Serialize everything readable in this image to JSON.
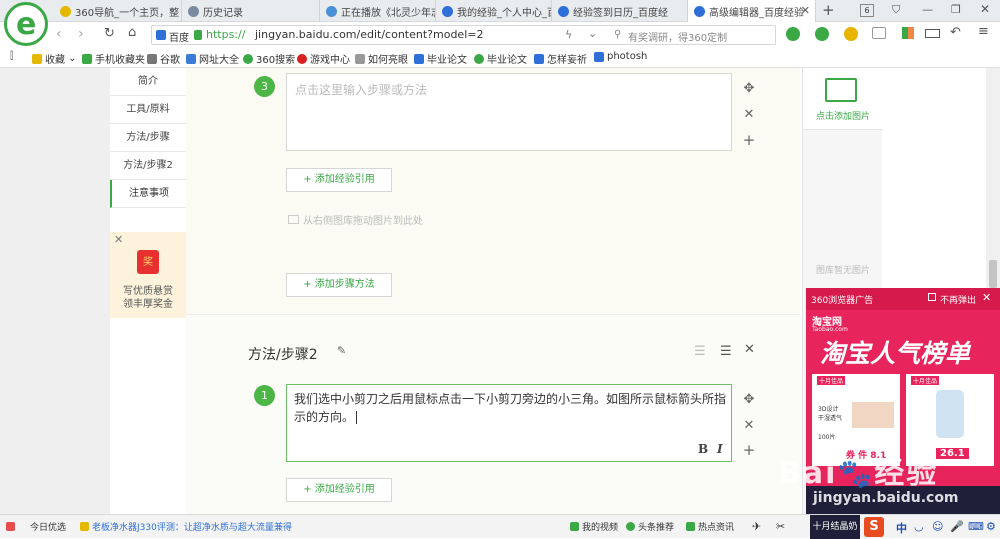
{
  "tabs": [
    {
      "label": "360导航_一个主页，整",
      "color": "#e5b800"
    },
    {
      "label": "历史记录",
      "color": "#7a8aa0"
    },
    {
      "label": "正在播放《北灵少年志",
      "color": "#4a8fd8"
    },
    {
      "label": "我的经验_个人中心_百",
      "color": "#2e6fd8"
    },
    {
      "label": "经验签到日历_百度经",
      "color": "#2e6fd8"
    },
    {
      "label": "高级编辑器_百度经验",
      "color": "#2e6fd8"
    }
  ],
  "tab_count": "6",
  "address": {
    "site_label": "百度",
    "protocol": "https://",
    "url": "jingyan.baidu.com/edit/content?model=2",
    "search_hint": "有奖调研，得360定制"
  },
  "bookmarks": [
    "收藏",
    "手机收藏夹",
    "谷歌",
    "网址大全",
    "360搜索",
    "游戏中心",
    "如何亮眼",
    "毕业论文",
    "毕业论文",
    "怎样妄祈",
    "photosh"
  ],
  "sidenav": [
    "简介",
    "工具/原料",
    "方法/步骤",
    "方法/步骤2",
    "注意事项"
  ],
  "sidenav_active": 4,
  "reward": {
    "badge": "奖",
    "line1": "写优质悬赏",
    "line2": "领丰厚奖金"
  },
  "step3": {
    "number": "3",
    "placeholder": "点击这里输入步骤或方法"
  },
  "add_ref_label": "+ 添加经验引用",
  "drag_hint": "从右侧图库拖动图片到此处",
  "add_step_label": "+ 添加步骤方法",
  "section2": {
    "title": "方法/步骤2",
    "step_number": "1",
    "text": "我们选中小剪刀之后用鼠标点击一下小剪刀旁边的小三角。如图所示鼠标箭头所指示的方向。",
    "bold": "B",
    "italic": "I"
  },
  "add_ref_label_2": "+ 添加经验引用",
  "right_panel": {
    "add_image": "点击添加图片",
    "empty": "图库暂无图片"
  },
  "ad": {
    "source": "360浏览器广告",
    "no_show": "不再弹出",
    "brand": "淘宝网",
    "brand_sub": "Taobao.com",
    "headline": "淘宝人气榜单",
    "card1_top": "十月佳品",
    "card1_line1": "3D设计",
    "card1_line2": "干湿透气",
    "card1_count": "100片",
    "card1_price": "券 件 8.1",
    "card2_top": "十月佳品",
    "card2_price": "26.1"
  },
  "watermark": {
    "brand": "Bai",
    "suffix": "经验",
    "url": "jingyan.baidu.com"
  },
  "status": {
    "today": "今日优选",
    "news": "老板净水器J330评测：让超净水质与超大流量兼得",
    "video": "我的视频",
    "headline": "头条推荐",
    "hot": "热点资讯",
    "ad_tile": "十月结晶奶",
    "ime": "中"
  }
}
